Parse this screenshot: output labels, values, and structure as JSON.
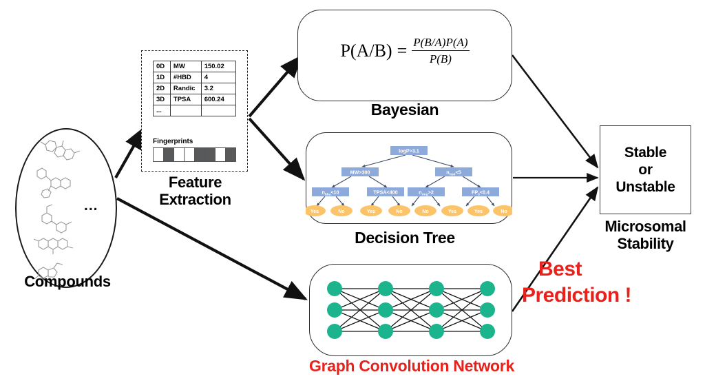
{
  "compounds": {
    "label": "Compounds",
    "ellipsis": "..."
  },
  "feature_extraction": {
    "caption_line1": "Feature",
    "caption_line2": "Extraction",
    "table": {
      "rows": [
        {
          "dim": "0D",
          "name": "MW",
          "value": "150.02"
        },
        {
          "dim": "1D",
          "name": "#HBD",
          "value": "4"
        },
        {
          "dim": "2D",
          "name": "Randic",
          "value": "3.2"
        },
        {
          "dim": "3D",
          "name": "TPSA",
          "value": "600.24"
        },
        {
          "dim": "...",
          "name": "",
          "value": ""
        }
      ]
    },
    "fingerprints_label": "Fingerprints",
    "fingerprint_bits": [
      0,
      1,
      0,
      0,
      1,
      1,
      0,
      1
    ],
    "fingerprint_on_color": "#58595b",
    "fingerprint_off_color": "#ffffff"
  },
  "models": {
    "bayesian": {
      "caption": "Bayesian",
      "formula_lhs": "P(A/B)",
      "formula_equals": "=",
      "formula_numerator": "P(B/A)P(A)",
      "formula_denominator": "P(B)"
    },
    "decision_tree": {
      "caption": "Decision Tree",
      "node_color": "#8eaadb",
      "leaf_color": "#fbc46a",
      "root": {
        "text": "logP>3.1"
      },
      "level2": [
        {
          "text": "MW>300"
        },
        {
          "text": "n",
          "sub": "hbd",
          "op": "<5"
        }
      ],
      "level3": [
        {
          "text": "n",
          "sub": "hba",
          "op": "<10"
        },
        {
          "text": "TPSA<400"
        },
        {
          "text": "n",
          "sub": "ring",
          "op": ">2"
        },
        {
          "text": "FP",
          "sub": "3",
          "op": "<0.4"
        }
      ],
      "leaves": [
        "Yes",
        "No",
        "Yes",
        "No",
        "No",
        "Yes",
        "Yes",
        "No"
      ]
    },
    "gcn": {
      "caption": "Graph Convolution Network",
      "caption_color": "#e8211b",
      "node_color": "#1cb48c",
      "layers": 4,
      "nodes_per_layer": 3
    }
  },
  "output": {
    "line1": "Stable",
    "line2": "or",
    "line3": "Unstable",
    "caption_line1": "Microsomal",
    "caption_line2": "Stability"
  },
  "annotation": {
    "best_prediction_line1": "Best",
    "best_prediction_line2": "Prediction !",
    "color": "#e8211b"
  }
}
